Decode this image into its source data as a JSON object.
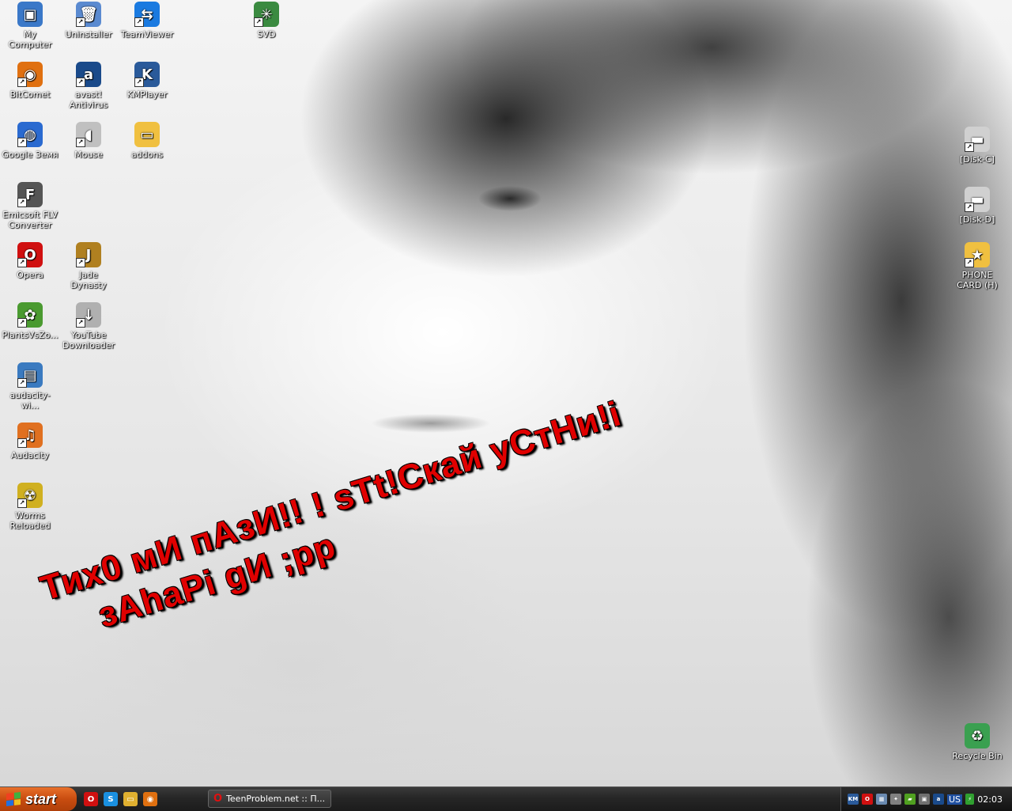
{
  "desktop_icons": [
    {
      "label": "My Computer",
      "icon": "my-computer-icon",
      "color": "#3a78c8"
    },
    {
      "label": "Uninstaller",
      "icon": "uninstaller-icon",
      "color": "#5a8ad0"
    },
    {
      "label": "TeamViewer",
      "icon": "teamviewer-icon",
      "color": "#1a7ae0"
    },
    {
      "label": "SVD",
      "icon": "spider-icon",
      "color": "#3a8a40"
    },
    {
      "label": "BitComet",
      "icon": "bitcomet-icon",
      "color": "#e07010"
    },
    {
      "label": "avast! Antivirus",
      "icon": "avast-icon",
      "color": "#1a4a8a"
    },
    {
      "label": "KMPlayer",
      "icon": "kmplayer-icon",
      "color": "#2a5a9a"
    },
    {
      "label": "Google Земя",
      "icon": "google-earth-icon",
      "color": "#2a6ad0"
    },
    {
      "label": "Mouse",
      "icon": "mouse-icon",
      "color": "#c0c0c0"
    },
    {
      "label": "addons",
      "icon": "folder-icon",
      "color": "#f0c040"
    },
    {
      "label": "Emicsoft FLV Converter",
      "icon": "flv-converter-icon",
      "color": "#555555"
    },
    {
      "label": "Opera",
      "icon": "opera-icon",
      "color": "#d01010"
    },
    {
      "label": "Jade Dynasty",
      "icon": "jade-dynasty-icon",
      "color": "#b08020"
    },
    {
      "label": "PlantsVsZo...",
      "icon": "plants-vs-zombies-icon",
      "color": "#4a9a30"
    },
    {
      "label": "YouTube Downloader",
      "icon": "youtube-downloader-icon",
      "color": "#b0b0b0"
    },
    {
      "label": "audacity-wi...",
      "icon": "installer-icon",
      "color": "#3a7ac0"
    },
    {
      "label": "Audacity",
      "icon": "audacity-icon",
      "color": "#e07020"
    },
    {
      "label": "Worms Reloaded",
      "icon": "worms-reloaded-icon",
      "color": "#d0b020"
    },
    {
      "label": "[Disk-C]",
      "icon": "disk-drive-icon",
      "color": "#d0d0d0"
    },
    {
      "label": "[Disk-D]",
      "icon": "disk-drive-icon",
      "color": "#d0d0d0"
    },
    {
      "label": "PHONE CARD (H)",
      "icon": "folder-star-icon",
      "color": "#f0c040"
    },
    {
      "label": "Recycle Bin",
      "icon": "recycle-bin-icon",
      "color": "#3aa050"
    }
  ],
  "wallpaper_text": {
    "line1": "Тих0 мИ пАзИ!! ! sTt!Скай уСтНи!i",
    "line2": "зАhаPi gИ ;pp"
  },
  "taskbar": {
    "start_label": "start",
    "quick_launch": [
      {
        "icon": "opera-icon",
        "glyph": "O",
        "color": "#d01010"
      },
      {
        "icon": "skype-icon",
        "glyph": "S",
        "color": "#1a90e0"
      },
      {
        "icon": "folder-icon",
        "glyph": "▭",
        "color": "#e0b030"
      },
      {
        "icon": "bitcomet-icon",
        "glyph": "◉",
        "color": "#e07010"
      }
    ],
    "active_task": "TeenProblem.net :: П..."
  },
  "tray": {
    "icons": [
      {
        "icon": "kmp-tray-icon",
        "glyph": "KM",
        "color": "#2a5a9a"
      },
      {
        "icon": "opera-tray-icon",
        "glyph": "O",
        "color": "#d01010"
      },
      {
        "icon": "network-icon",
        "glyph": "▦",
        "color": "#6a8ab0"
      },
      {
        "icon": "satellite-icon",
        "glyph": "✦",
        "color": "#808080"
      },
      {
        "icon": "nvidia-icon",
        "glyph": "▰",
        "color": "#50a020"
      },
      {
        "icon": "monitor-icon",
        "glyph": "▣",
        "color": "#707070"
      },
      {
        "icon": "avast-tray-icon",
        "glyph": "a",
        "color": "#1a4a8a"
      }
    ],
    "language": "US",
    "power_icon": {
      "icon": "power-icon",
      "glyph": "⚡",
      "color": "#30a030"
    },
    "clock": "02:03"
  }
}
